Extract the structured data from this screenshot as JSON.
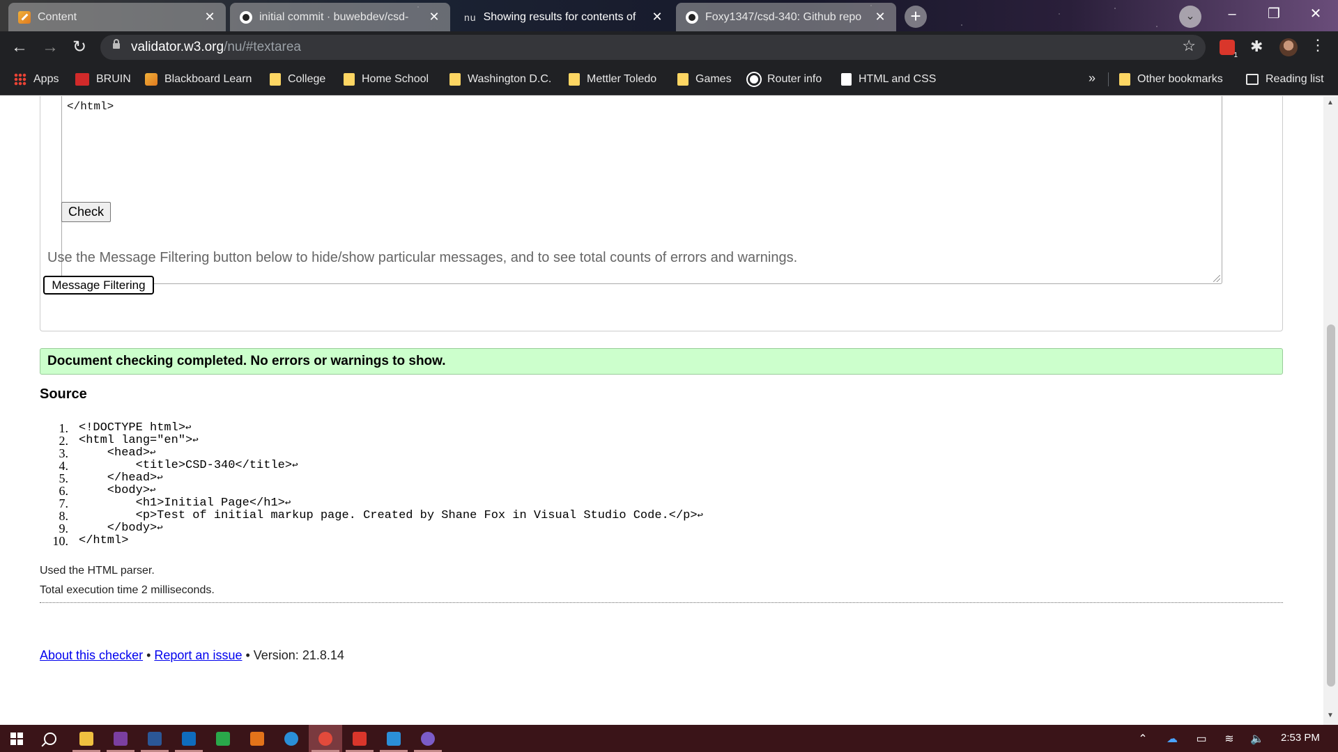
{
  "browser": {
    "tabs": [
      {
        "label": "Content",
        "icon": "pencil-icon",
        "state": "inactive"
      },
      {
        "label": "initial commit · buwebdev/csd-",
        "icon": "github-icon",
        "state": "inactive"
      },
      {
        "label": "Showing results for contents of",
        "icon": "nu",
        "state": "active"
      },
      {
        "label": "Foxy1347/csd-340: Github repo",
        "icon": "github-icon",
        "state": "inactive"
      }
    ],
    "url_host": "validator.w3.org",
    "url_path": "/nu/#textarea",
    "extension_badge": "1"
  },
  "bookmarks": [
    {
      "label": "Apps",
      "icon": "apps-grid-icon"
    },
    {
      "label": "BRUIN",
      "icon": "bruin-icon"
    },
    {
      "label": "Blackboard Learn",
      "icon": "blackboard-icon"
    },
    {
      "label": "College",
      "icon": "folder-icon"
    },
    {
      "label": "Home School",
      "icon": "folder-icon"
    },
    {
      "label": "Washington D.C.",
      "icon": "folder-icon"
    },
    {
      "label": "Mettler Toledo",
      "icon": "folder-icon"
    },
    {
      "label": "Games",
      "icon": "folder-icon"
    },
    {
      "label": "Router info",
      "icon": "globe-icon"
    },
    {
      "label": "HTML and CSS",
      "icon": "document-icon"
    }
  ],
  "bookmarks_more": "»",
  "other_bookmarks": "Other bookmarks",
  "reading_list": "Reading list",
  "page": {
    "textarea_visible_text": "</html>",
    "check_label": "Check",
    "filter_note": "Use the Message Filtering button below to hide/show particular messages, and to see total counts of errors and warnings.",
    "filter_button": "Message Filtering",
    "success_message": "Document checking completed. No errors or warnings to show.",
    "source_heading": "Source",
    "source_lines": [
      {
        "num": "1.",
        "code": "<!DOCTYPE html>"
      },
      {
        "num": "2.",
        "code": "<html lang=\"en\">"
      },
      {
        "num": "3.",
        "code": "    <head>"
      },
      {
        "num": "4.",
        "code": "        <title>CSD-340</title>"
      },
      {
        "num": "5.",
        "code": "    </head>"
      },
      {
        "num": "6.",
        "code": "    <body>"
      },
      {
        "num": "7.",
        "code": "        <h1>Initial Page</h1>"
      },
      {
        "num": "8.",
        "code": "        <p>Test of initial markup page. Created by Shane Fox in Visual Studio Code.</p>"
      },
      {
        "num": "9.",
        "code": "    </body>"
      },
      {
        "num": "10.",
        "code": "</html>"
      }
    ],
    "line_end_glyph": "↩",
    "parser_note": "Used the HTML parser.",
    "exec_time": "Total execution time 2 milliseconds.",
    "footer": {
      "about": "About this checker",
      "sep1": " • ",
      "report": "Report an issue",
      "version": " • Version: 21.8.14"
    }
  },
  "taskbar": {
    "apps": [
      {
        "name": "file-explorer",
        "color": "#f0c040",
        "running": true
      },
      {
        "name": "onenote",
        "color": "#7b3fa0",
        "running": true
      },
      {
        "name": "word",
        "color": "#2b5797",
        "running": true
      },
      {
        "name": "outlook",
        "color": "#0f6cbd",
        "running": true
      },
      {
        "name": "dollar-app",
        "color": "#2aa84a",
        "running": false
      },
      {
        "name": "office",
        "color": "#e3731a",
        "running": false
      },
      {
        "name": "edge",
        "color": "#2a8fd8",
        "running": false
      },
      {
        "name": "chrome",
        "color": "#e24a3b",
        "running": true,
        "active": true
      },
      {
        "name": "todoist",
        "color": "#d9362b",
        "running": true
      },
      {
        "name": "vscode",
        "color": "#2b8fd8",
        "running": true
      },
      {
        "name": "github-desktop",
        "color": "#7b5cc8",
        "running": true
      }
    ],
    "time": "2:53 PM"
  }
}
